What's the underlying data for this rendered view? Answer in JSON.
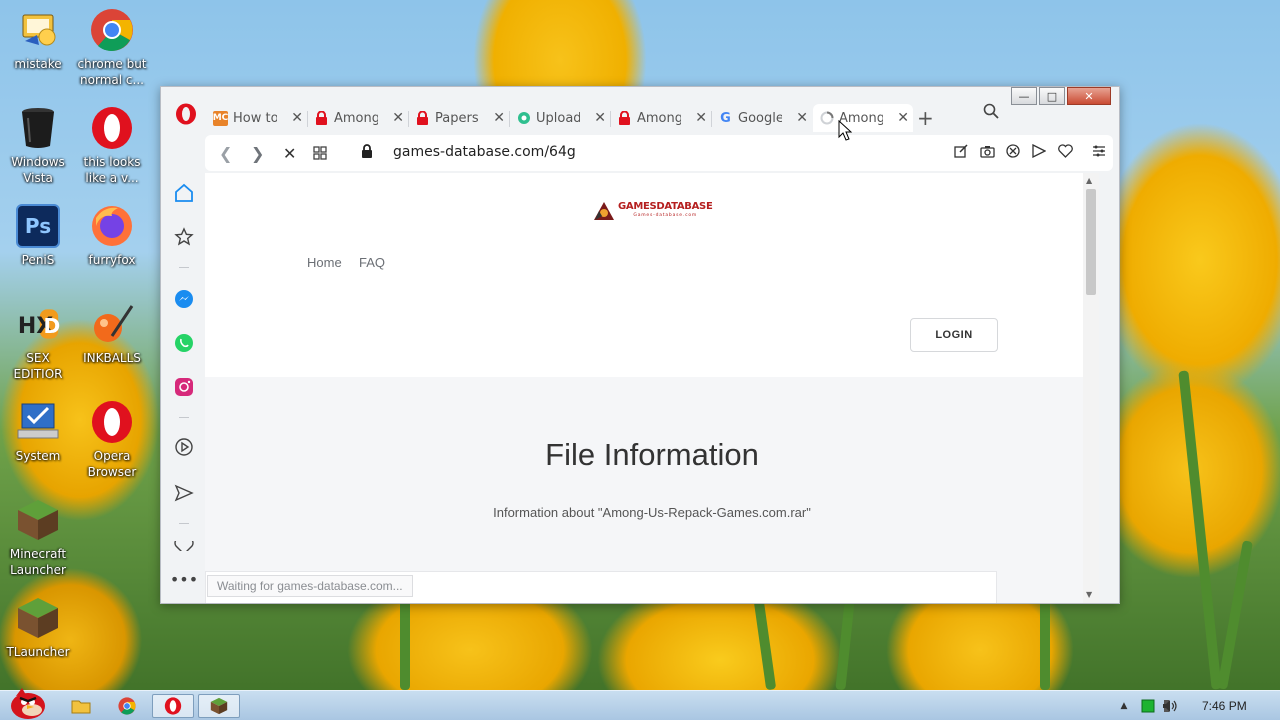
{
  "desktop": {
    "icons": [
      {
        "label": "mistake"
      },
      {
        "label": "chrome but normal c..."
      },
      {
        "label": "Windows Vista"
      },
      {
        "label": "this looks like a v..."
      },
      {
        "label": "PeniS"
      },
      {
        "label": "furryfox"
      },
      {
        "label": "SEX EDITIOR"
      },
      {
        "label": "INKBALLS"
      },
      {
        "label": "System"
      },
      {
        "label": "Opera Browser"
      },
      {
        "label": "Minecraft Launcher"
      },
      {
        "label": "TLauncher"
      }
    ]
  },
  "browser": {
    "tabs": [
      {
        "title": "How to",
        "favicon": "mc-icon"
      },
      {
        "title": "Among",
        "favicon": "red-lock-icon"
      },
      {
        "title": "Papers",
        "favicon": "red-lock-icon"
      },
      {
        "title": "Uploadi",
        "favicon": "green-logo-icon"
      },
      {
        "title": "Among",
        "favicon": "red-lock-icon"
      },
      {
        "title": "Google",
        "favicon": "google-icon"
      },
      {
        "title": "Among",
        "favicon": "loading-spinner-icon",
        "active": true
      }
    ],
    "url": "games-database.com/64g",
    "status": "Waiting for games-database.com..."
  },
  "page": {
    "logo_text": "GAMESDATABASE",
    "logo_subtext": "Games-database.com",
    "menu": [
      "Home",
      "FAQ"
    ],
    "login_label": "LOGIN",
    "title": "File Information",
    "subtitle": "Information about \"Among-Us-Repack-Games.com.rar\""
  },
  "taskbar": {
    "clock": "7:46 PM"
  },
  "colors": {
    "opera_red": "#e0111e",
    "sidebar_blue": "#1a8cf0"
  }
}
